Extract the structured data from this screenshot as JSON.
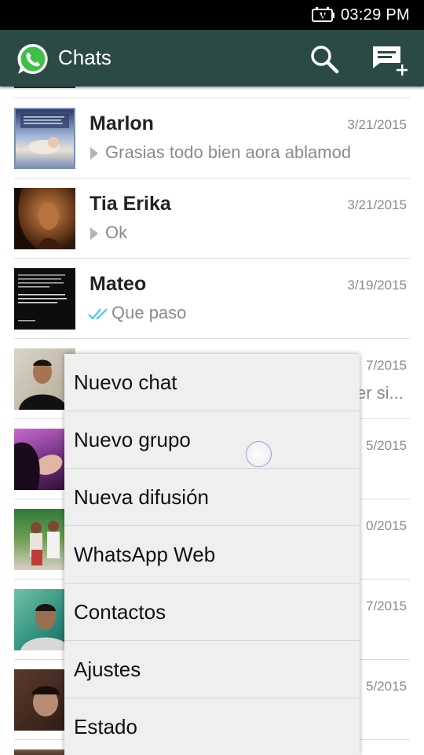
{
  "status_bar": {
    "time": "03:29 PM"
  },
  "app_bar": {
    "title": "Chats",
    "icons": {
      "logo": "whatsapp-logo-icon",
      "search": "search-icon",
      "new_chat": "new-chat-icon"
    }
  },
  "chats": [
    {
      "name": "Marlon",
      "date": "3/21/2015",
      "preview": "Grasias todo bien aora ablamod",
      "status_icon": "play-arrow-icon"
    },
    {
      "name": "Tia Erika",
      "date": "3/21/2015",
      "preview": "Ok",
      "status_icon": "play-arrow-icon"
    },
    {
      "name": "Mateo",
      "date": "3/19/2015",
      "preview": "Que paso",
      "status_icon": "double-check-icon"
    },
    {
      "name": "",
      "date": "7/2015",
      "preview": "er si...",
      "status_icon": ""
    },
    {
      "name": "",
      "date": "5/2015",
      "preview": "",
      "status_icon": ""
    },
    {
      "name": "",
      "date": "0/2015",
      "preview": "",
      "status_icon": ""
    },
    {
      "name": "",
      "date": "7/2015",
      "preview": "",
      "status_icon": ""
    },
    {
      "name": "",
      "date": "5/2015",
      "preview": "",
      "status_icon": ""
    }
  ],
  "menu": {
    "items": [
      "Nuevo chat",
      "Nuevo grupo",
      "Nueva difusión",
      "WhatsApp Web",
      "Contactos",
      "Ajustes",
      "Estado"
    ]
  },
  "colors": {
    "app_bar": "#2c4a45",
    "menu_bg": "#efefef",
    "read_check": "#4fc3f7"
  }
}
